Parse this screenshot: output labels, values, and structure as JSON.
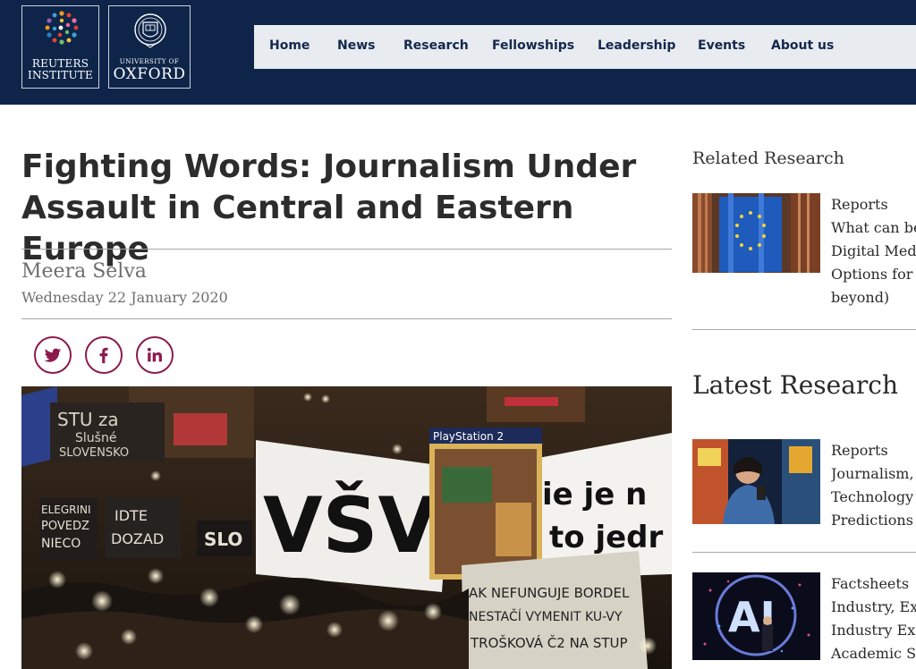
{
  "header": {
    "logo_reuters": {
      "line1": "REUTERS",
      "line2": "INSTITUTE"
    },
    "logo_oxford": {
      "line1": "UNIVERSITY OF",
      "line2": "OXFORD"
    },
    "nav": [
      "Home",
      "News",
      "Research",
      "Fellowships",
      "Leadership",
      "Events",
      "About us"
    ]
  },
  "article": {
    "title_lines": [
      "Fighting Words: Journalism Under",
      "Assault in Central and Eastern Europe"
    ],
    "author": "Meera Selva",
    "date": "Wednesday 22 January 2020",
    "share_icons": [
      "twitter-icon",
      "facebook-icon",
      "linkedin-icon"
    ],
    "hero_signs": {
      "sign1": [
        "STU za",
        "Slušné",
        "SLOVENSKO"
      ],
      "sign2": [
        "VŠV"
      ],
      "sign3": [
        "ie je n",
        "to jedr"
      ],
      "sign4": [
        "PlayStation 2"
      ],
      "sign5": [
        "AK NEFUNGUJE BORDEL",
        "NESTAČÍ VYMENIT KU-VY",
        "TROŠKOVÁ Č2 NA STUP"
      ],
      "sign6": [
        "IDTE",
        "DOZAD"
      ],
      "sign7": [
        "SLO"
      ],
      "sign8": [
        "ELEGRINI",
        "POVEDZ",
        "NIECO"
      ]
    }
  },
  "sidebar": {
    "related_heading": "Related Research",
    "latest_heading": "Latest Research",
    "related": [
      {
        "type": "Reports",
        "lines": [
          "What can be",
          "Digital Med",
          "Options for",
          "beyond)"
        ]
      }
    ],
    "latest": [
      {
        "type": "Reports",
        "lines": [
          "Journalism, ",
          "Technology ",
          "Predictions "
        ]
      },
      {
        "type": "Factsheets",
        "lines": [
          "Industry, Ex",
          "Industry Ex",
          "Academic Sc"
        ]
      }
    ],
    "thumb_ai_text": "AI"
  },
  "colors": {
    "header_bg": "#0e2549",
    "nav_bg": "#e8ebef",
    "nav_text": "#13284d",
    "share_accent": "#8c1b4d"
  }
}
